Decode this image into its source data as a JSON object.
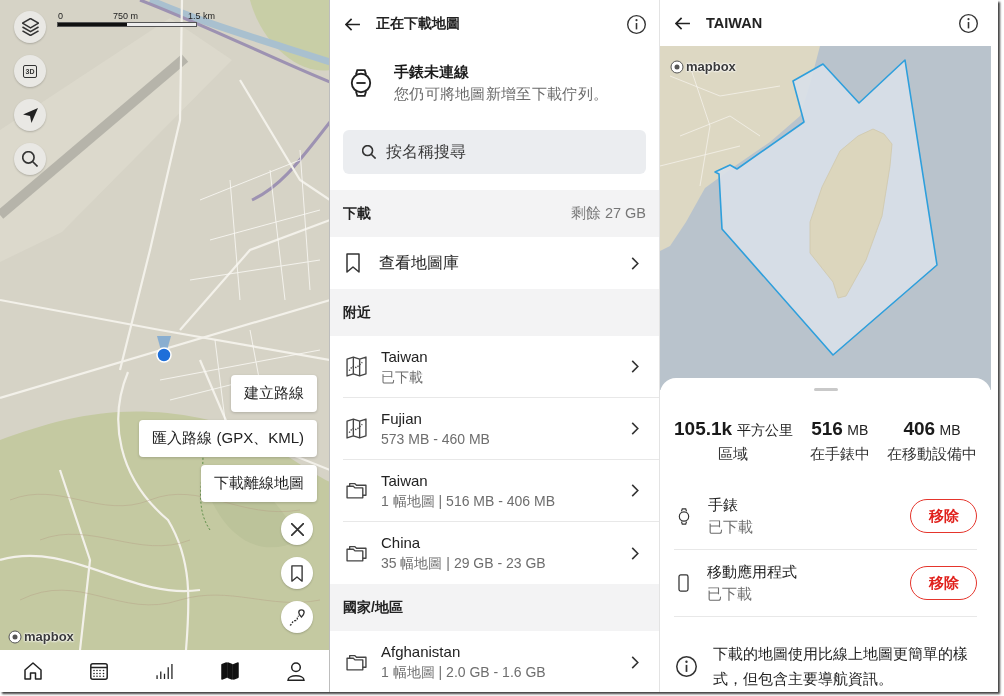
{
  "map_screen": {
    "scale_labels": [
      "0",
      "750 m",
      "1.5 km"
    ],
    "controls": [
      {
        "kind": "layers"
      },
      {
        "kind": "perspective",
        "label": "3D"
      },
      {
        "kind": "locate"
      },
      {
        "kind": "search"
      }
    ],
    "attribution": "mapbox",
    "menu": [
      "建立路線",
      "匯入路線 (GPX、KML)",
      "下載離線地圖"
    ],
    "fabs": [
      {
        "kind": "close"
      },
      {
        "kind": "bookmark"
      },
      {
        "kind": "route"
      }
    ],
    "nav": [
      {
        "kind": "home",
        "selected": false
      },
      {
        "kind": "calendar",
        "selected": false
      },
      {
        "kind": "stats",
        "selected": false
      },
      {
        "kind": "map",
        "selected": true
      },
      {
        "kind": "profile",
        "selected": false
      }
    ]
  },
  "downloads_screen": {
    "title": "正在下載地圖",
    "watch_status": {
      "title": "手錶未連線",
      "subtitle": "您仍可將地圖新增至下載佇列。"
    },
    "search": {
      "placeholder": "按名稱搜尋"
    },
    "sections": [
      {
        "title": "下載",
        "note": "剩餘 27 GB",
        "rows": [
          {
            "kind": "library",
            "title": "查看地圖庫"
          }
        ]
      },
      {
        "title": "附近",
        "rows": [
          {
            "kind": "map",
            "title": "Taiwan",
            "subtitle": "已下載"
          },
          {
            "kind": "map",
            "title": "Fujian",
            "subtitle": "573 MB - 460 MB"
          },
          {
            "kind": "folder",
            "title": "Taiwan",
            "subtitle": "1 幅地圖 | 516 MB - 406 MB"
          },
          {
            "kind": "folder",
            "title": "China",
            "subtitle": "35 幅地圖 | 29 GB - 23 GB"
          }
        ]
      },
      {
        "title": "國家/地區",
        "rows": [
          {
            "kind": "folder",
            "title": "Afghanistan",
            "subtitle": "1 幅地圖 | 2.0 GB - 1.6 GB"
          }
        ]
      }
    ]
  },
  "region_screen": {
    "title": "TAIWAN",
    "attribution": "mapbox",
    "stats": [
      {
        "value": "105.1k",
        "unit": "平方公里",
        "label": "區域"
      },
      {
        "value": "516",
        "unit": "MB",
        "label": "在手錶中"
      },
      {
        "value": "406",
        "unit": "MB",
        "label": "在移動設備中"
      }
    ],
    "devices": [
      {
        "kind": "watch",
        "name": "手錶",
        "status": "已下載",
        "action": "移除"
      },
      {
        "kind": "phone",
        "name": "移動應用程式",
        "status": "已下載",
        "action": "移除"
      }
    ],
    "note": "下載的地圖使用比線上地圖更簡單的樣式，但包含主要導航資訊。"
  }
}
